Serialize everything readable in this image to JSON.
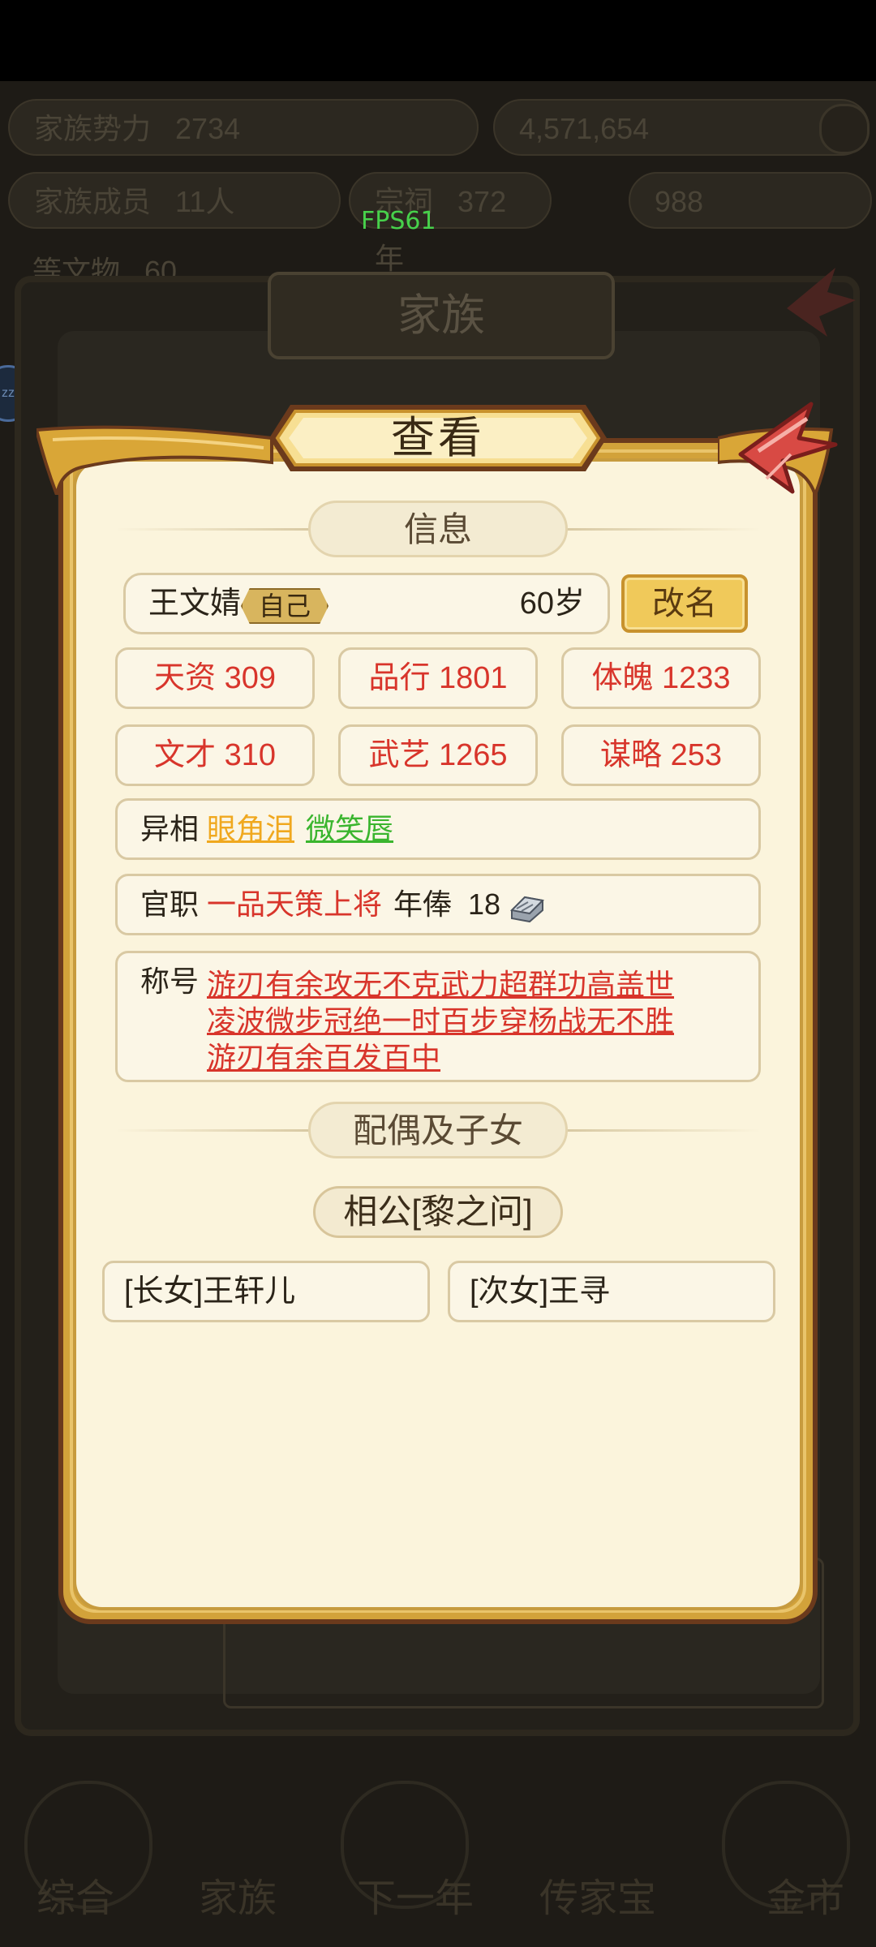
{
  "fps": "FPS61",
  "background": {
    "stats_row1": [
      "家族势力",
      "2734",
      "4,571,654"
    ],
    "stats_row2": [
      "家族成员",
      "11人",
      "宗祠",
      "372年",
      "988"
    ],
    "stats_row3": [
      "等文物",
      "60"
    ],
    "window_title": "家族",
    "side_badge": "zz",
    "bottom_nav": [
      "综合",
      "家族",
      "下一年",
      "传家宝",
      "金市"
    ]
  },
  "dialog": {
    "title": "查看",
    "info_header": "信息",
    "name": "王文婧",
    "self_tag": "自己",
    "age": "60岁",
    "rename_button": "改名",
    "stats": [
      {
        "label": "天资 309"
      },
      {
        "label": "品行 1801"
      },
      {
        "label": "体魄 1233"
      },
      {
        "label": "文才 310"
      },
      {
        "label": "武艺 1265"
      },
      {
        "label": "谋略 253"
      }
    ],
    "traits_label": "异相",
    "traits": [
      {
        "text": "眼角泪",
        "color": "#f0a81e"
      },
      {
        "text": "微笑唇",
        "color": "#3ab52e"
      }
    ],
    "office_label": "官职",
    "office_value": "一品天策上将",
    "salary_label": "年俸",
    "salary_value": "18",
    "titles_label": "称号",
    "titles_lines": [
      "游刃有余攻无不克武力超群功高盖世",
      "凌波微步冠绝一时百步穿杨战无不胜",
      "游刃有余百发百中"
    ],
    "family_header": "配偶及子女",
    "spouse": "相公[黎之问]",
    "children": [
      "[长女]王轩儿",
      "[次女]王寻"
    ]
  },
  "colors": {
    "stat_red": "#d8352b",
    "paper": "#fbf4dc",
    "gold_frame": "#d2a23a"
  }
}
